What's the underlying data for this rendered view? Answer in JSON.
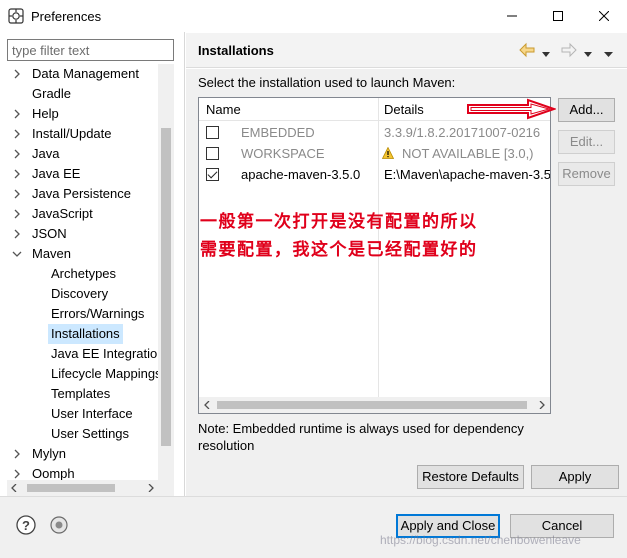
{
  "window": {
    "title": "Preferences"
  },
  "left": {
    "filter_placeholder": "type filter text",
    "tree": [
      {
        "label": "Data Management",
        "level": 0,
        "expander": "collapsed"
      },
      {
        "label": "Gradle",
        "level": 0,
        "expander": "none"
      },
      {
        "label": "Help",
        "level": 0,
        "expander": "collapsed"
      },
      {
        "label": "Install/Update",
        "level": 0,
        "expander": "collapsed"
      },
      {
        "label": "Java",
        "level": 0,
        "expander": "collapsed"
      },
      {
        "label": "Java EE",
        "level": 0,
        "expander": "collapsed"
      },
      {
        "label": "Java Persistence",
        "level": 0,
        "expander": "collapsed"
      },
      {
        "label": "JavaScript",
        "level": 0,
        "expander": "collapsed"
      },
      {
        "label": "JSON",
        "level": 0,
        "expander": "collapsed"
      },
      {
        "label": "Maven",
        "level": 0,
        "expander": "expanded"
      },
      {
        "label": "Archetypes",
        "level": 1,
        "expander": "none"
      },
      {
        "label": "Discovery",
        "level": 1,
        "expander": "none"
      },
      {
        "label": "Errors/Warnings",
        "level": 1,
        "expander": "none"
      },
      {
        "label": "Installations",
        "level": 1,
        "expander": "none",
        "selected": true
      },
      {
        "label": "Java EE Integration",
        "level": 1,
        "expander": "none"
      },
      {
        "label": "Lifecycle Mappings",
        "level": 1,
        "expander": "none"
      },
      {
        "label": "Templates",
        "level": 1,
        "expander": "none"
      },
      {
        "label": "User Interface",
        "level": 1,
        "expander": "none"
      },
      {
        "label": "User Settings",
        "level": 1,
        "expander": "none"
      },
      {
        "label": "Mylyn",
        "level": 0,
        "expander": "collapsed"
      },
      {
        "label": "Oomph",
        "level": 0,
        "expander": "collapsed"
      }
    ]
  },
  "page": {
    "title": "Installations",
    "description": "Select the installation used to launch Maven:",
    "table": {
      "columns": [
        "Name",
        "Details"
      ],
      "rows": [
        {
          "checked": false,
          "enabled": false,
          "name": "EMBEDDED",
          "details": "3.3.9/1.8.2.20171007-0216",
          "warning": false
        },
        {
          "checked": false,
          "enabled": false,
          "name": "WORKSPACE",
          "details": "NOT AVAILABLE [3.0,)",
          "warning": true
        },
        {
          "checked": true,
          "enabled": true,
          "name": "apache-maven-3.5.0",
          "details": "E:\\Maven\\apache-maven-3.5",
          "warning": false
        }
      ]
    },
    "buttons": {
      "add": "Add...",
      "edit": "Edit...",
      "remove": "Remove"
    },
    "note": "Note: Embedded runtime is always used for dependency resolution",
    "restore_defaults": "Restore Defaults",
    "apply": "Apply"
  },
  "footer": {
    "apply_and_close": "Apply and Close",
    "cancel": "Cancel"
  },
  "annotation": {
    "line1": "一般第一次打开是没有配置的所以",
    "line2": "需要配置，我这个是已经配置好的"
  },
  "watermark": "https://blog.csdn.net/chenbowenleave",
  "colors": {
    "selection": "#cce8ff",
    "annotation_red": "#e0001b",
    "default_button_border": "#0078d7"
  }
}
